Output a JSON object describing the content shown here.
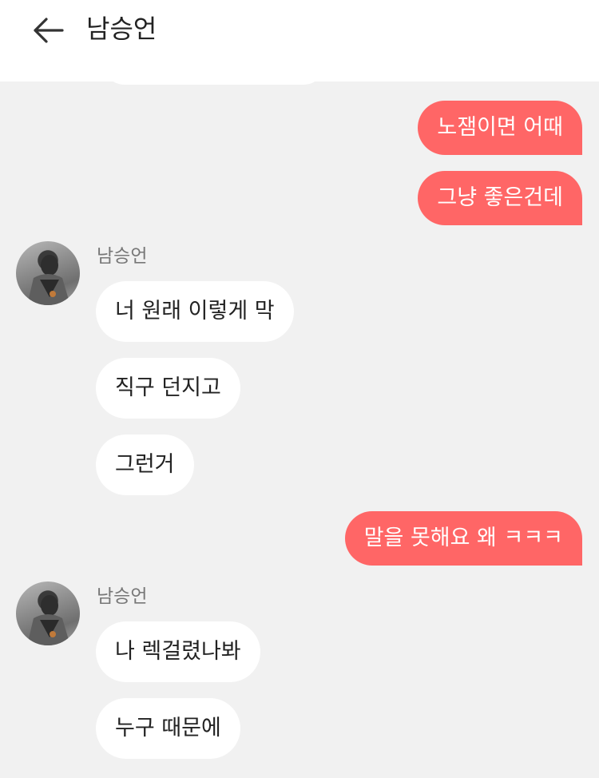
{
  "header": {
    "title": "남승언",
    "back_icon": "arrow-left-icon"
  },
  "colors": {
    "outgoing_bubble": "#ff6666",
    "incoming_bubble": "#ffffff",
    "background": "#f1f1f1"
  },
  "messages": [
    {
      "direction": "out",
      "text": "노잼이면 어때"
    },
    {
      "direction": "out",
      "text": "그냥 좋은건데"
    },
    {
      "direction": "in",
      "sender": "남승언",
      "text": "너 원래 이렇게 막"
    },
    {
      "direction": "in",
      "text": "직구 던지고"
    },
    {
      "direction": "in",
      "text": "그런거"
    },
    {
      "direction": "out",
      "text": "말을 못해요 왜 ㅋㅋㅋ"
    },
    {
      "direction": "in",
      "sender": "남승언",
      "text": "나 렉걸렸나봐"
    },
    {
      "direction": "in",
      "text": "누구 때문에"
    }
  ]
}
